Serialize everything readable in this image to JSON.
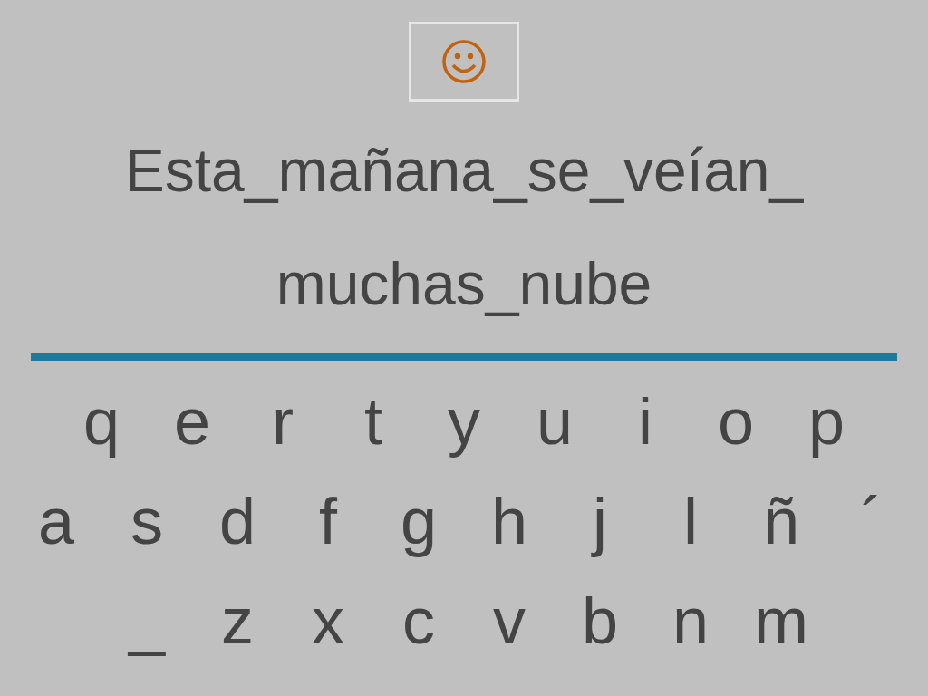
{
  "sentence_lines": [
    "Esta_mañana_se_veían_",
    "muchas_nube"
  ],
  "keyboard": {
    "rows": [
      [
        "q",
        "e",
        "r",
        "t",
        "y",
        "u",
        "i",
        "o",
        "p"
      ],
      [
        "a",
        "s",
        "d",
        "f",
        "g",
        "h",
        "j",
        "l",
        "ñ",
        "´"
      ],
      [
        "_",
        "z",
        "x",
        "c",
        "v",
        "b",
        "n",
        "m"
      ]
    ]
  }
}
